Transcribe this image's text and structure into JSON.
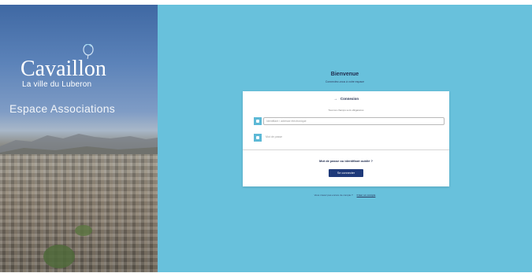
{
  "brand": {
    "name": "Cavaillon",
    "tagline": "La ville du Luberon",
    "portal": "Espace Associations"
  },
  "welcome": {
    "title": "Bienvenue",
    "subtitle": "Connectez-vous à votre espace"
  },
  "login": {
    "title": "Connexion",
    "hint": "Tous les champs sont obligatoires",
    "email_placeholder": "Identifiant / adresse électronique",
    "password_placeholder": "Mot de passe",
    "forgot_label": "Mot de passe ou identifiant oublié ?",
    "submit_label": "Se connecter"
  },
  "footer": {
    "text": "Vous n'avez pas encore de compte ?",
    "link": "Créer un compte"
  },
  "colors": {
    "panel_bg": "#68c1dc",
    "button_bg": "#1f3a7a",
    "field_icon_bg": "#5db9d6"
  }
}
